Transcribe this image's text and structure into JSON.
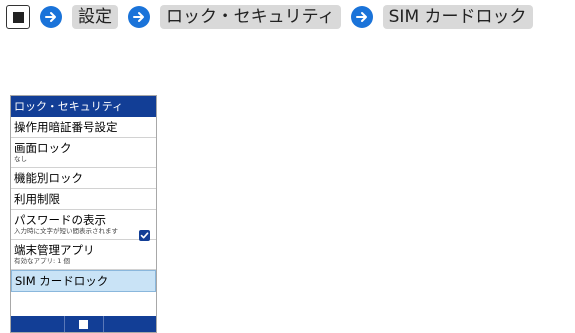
{
  "breadcrumb": {
    "center_key_icon": "square-key-icon",
    "arrow_icon": "arrow-right-circle-icon",
    "steps": [
      "設定",
      "ロック・セキュリティ",
      "SIM カードロック"
    ]
  },
  "screen": {
    "title": "ロック・セキュリティ",
    "items": [
      {
        "label": "操作用暗証番号設定",
        "sub": ""
      },
      {
        "label": "画面ロック",
        "sub": "なし"
      },
      {
        "label": "機能別ロック",
        "sub": ""
      },
      {
        "label": "利用制限",
        "sub": ""
      },
      {
        "label": "パスワードの表示",
        "sub": "入力時に文字が短い間表示されます",
        "checked": true
      },
      {
        "label": "端末管理アプリ",
        "sub": "有効なアプリ: 1 個"
      },
      {
        "label": "SIM カードロック",
        "sub": "",
        "selected": true
      }
    ],
    "softkey_center_icon": "square-key-icon"
  },
  "colors": {
    "title_bar": "#123e96",
    "selection": "#c9e3f6",
    "arrow": "#1a73d9",
    "crumb_bg": "#d9d9d9"
  }
}
